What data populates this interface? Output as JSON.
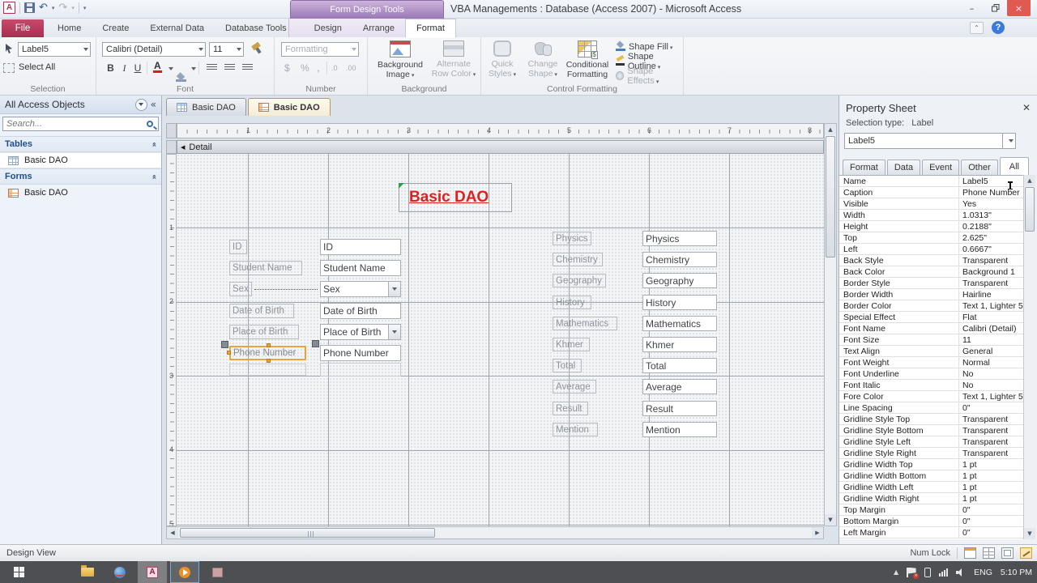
{
  "titlebar": {
    "contextual_group": "Form Design Tools",
    "title": "VBA Managements : Database (Access 2007)  -  Microsoft Access"
  },
  "tabs": {
    "file": "File",
    "main": [
      "Home",
      "Create",
      "External Data",
      "Database Tools"
    ],
    "contextual": [
      "Design",
      "Arrange",
      "Format"
    ],
    "active": "Format"
  },
  "ribbon": {
    "selection": {
      "caption": "Selection",
      "object_selector_value": "Label5",
      "select_all_label": "Select All"
    },
    "font": {
      "caption": "Font",
      "font_name": "Calibri (Detail)",
      "font_size": "11",
      "bold_label": "B",
      "italic_label": "I",
      "underline_label": "U",
      "font_color_label": "A"
    },
    "number": {
      "caption": "Number",
      "formatting_placeholder": "Formatting",
      "currency_label": "$",
      "percent_label": "%",
      "comma_label": ",",
      "inc_dec_label": ".0",
      "dec_dec_label": ".00"
    },
    "background": {
      "caption": "Background",
      "background_image_label": "Background\nImage",
      "alternate_row_color_label": "Alternate\nRow Color"
    },
    "control_formatting": {
      "caption": "Control Formatting",
      "quick_styles_label": "Quick\nStyles",
      "change_shape_label": "Change\nShape",
      "conditional_formatting_label": "Conditional\nFormatting",
      "shape_fill_label": "Shape Fill",
      "shape_outline_label": "Shape Outline",
      "shape_effects_label": "Shape Effects"
    }
  },
  "navpane": {
    "header": "All Access Objects",
    "search_placeholder": "Search...",
    "groups": [
      {
        "label": "Tables",
        "items": [
          {
            "label": "Basic DAO",
            "icon": "table-icon",
            "selected": true
          }
        ]
      },
      {
        "label": "Forms",
        "items": [
          {
            "label": "Basic DAO",
            "icon": "form-icon",
            "selected": false
          }
        ]
      }
    ]
  },
  "document": {
    "tabs": [
      {
        "label": "Basic DAO",
        "icon": "table-icon",
        "active": false
      },
      {
        "label": "Basic DAO",
        "icon": "form-icon",
        "active": true
      }
    ],
    "section_header": "Detail",
    "h_ruler": [
      "1",
      "2",
      "3",
      "4",
      "5",
      "6",
      "7",
      "8"
    ],
    "v_ruler": [
      "1",
      "2",
      "3",
      "4",
      "5"
    ],
    "form": {
      "title": "Basic DAO",
      "field_labels": [
        "ID",
        "Student Name",
        "Sex",
        "Date of Birth",
        "Place of Birth",
        "Phone Number"
      ],
      "field_textboxes": [
        "ID",
        "Student Name",
        "Sex",
        "Date of Birth",
        "Place of Birth",
        "Phone Number"
      ],
      "subjects": [
        "Physics",
        "Chemistry",
        "Geography",
        "History",
        "Mathematics",
        "Khmer",
        "Total",
        "Average",
        "Result",
        "Mention"
      ],
      "selected_control": "Phone Number"
    }
  },
  "property_sheet": {
    "title": "Property Sheet",
    "selection_type_label": "Selection type:",
    "selection_type_value": "Label",
    "selector_value": "Label5",
    "tabs": [
      "Format",
      "Data",
      "Event",
      "Other",
      "All"
    ],
    "active_tab": "All",
    "rows": [
      {
        "label": "Name",
        "value": "Label5"
      },
      {
        "label": "Caption",
        "value": "Phone Number"
      },
      {
        "label": "Visible",
        "value": "Yes"
      },
      {
        "label": "Width",
        "value": "1.0313\""
      },
      {
        "label": "Height",
        "value": "0.2188\""
      },
      {
        "label": "Top",
        "value": "2.625\""
      },
      {
        "label": "Left",
        "value": "0.6667\""
      },
      {
        "label": "Back Style",
        "value": "Transparent"
      },
      {
        "label": "Back Color",
        "value": "Background 1"
      },
      {
        "label": "Border Style",
        "value": "Transparent"
      },
      {
        "label": "Border Width",
        "value": "Hairline"
      },
      {
        "label": "Border Color",
        "value": "Text 1, Lighter 5"
      },
      {
        "label": "Special Effect",
        "value": "Flat"
      },
      {
        "label": "Font Name",
        "value": "Calibri (Detail)"
      },
      {
        "label": "Font Size",
        "value": "11"
      },
      {
        "label": "Text Align",
        "value": "General"
      },
      {
        "label": "Font Weight",
        "value": "Normal"
      },
      {
        "label": "Font Underline",
        "value": "No"
      },
      {
        "label": "Font Italic",
        "value": "No"
      },
      {
        "label": "Fore Color",
        "value": "Text 1, Lighter 5"
      },
      {
        "label": "Line Spacing",
        "value": "0\""
      },
      {
        "label": "Gridline Style Top",
        "value": "Transparent"
      },
      {
        "label": "Gridline Style Bottom",
        "value": "Transparent"
      },
      {
        "label": "Gridline Style Left",
        "value": "Transparent"
      },
      {
        "label": "Gridline Style Right",
        "value": "Transparent"
      },
      {
        "label": "Gridline Width Top",
        "value": "1 pt"
      },
      {
        "label": "Gridline Width Bottom",
        "value": "1 pt"
      },
      {
        "label": "Gridline Width Left",
        "value": "1 pt"
      },
      {
        "label": "Gridline Width Right",
        "value": "1 pt"
      },
      {
        "label": "Top Margin",
        "value": "0\""
      },
      {
        "label": "Bottom Margin",
        "value": "0\""
      },
      {
        "label": "Left Margin",
        "value": "0\""
      }
    ]
  },
  "statusbar": {
    "mode": "Design View",
    "num_lock": "Num Lock"
  },
  "taskbar": {
    "language": "ENG",
    "time": "5:10 PM"
  },
  "colors": {
    "file_tab": "#b93a5b",
    "contextual_purple": "#9878b6",
    "form_title_red": "#e0201f",
    "selection_orange": "#eda33c",
    "active_doc_tab": "#f8f0da"
  }
}
